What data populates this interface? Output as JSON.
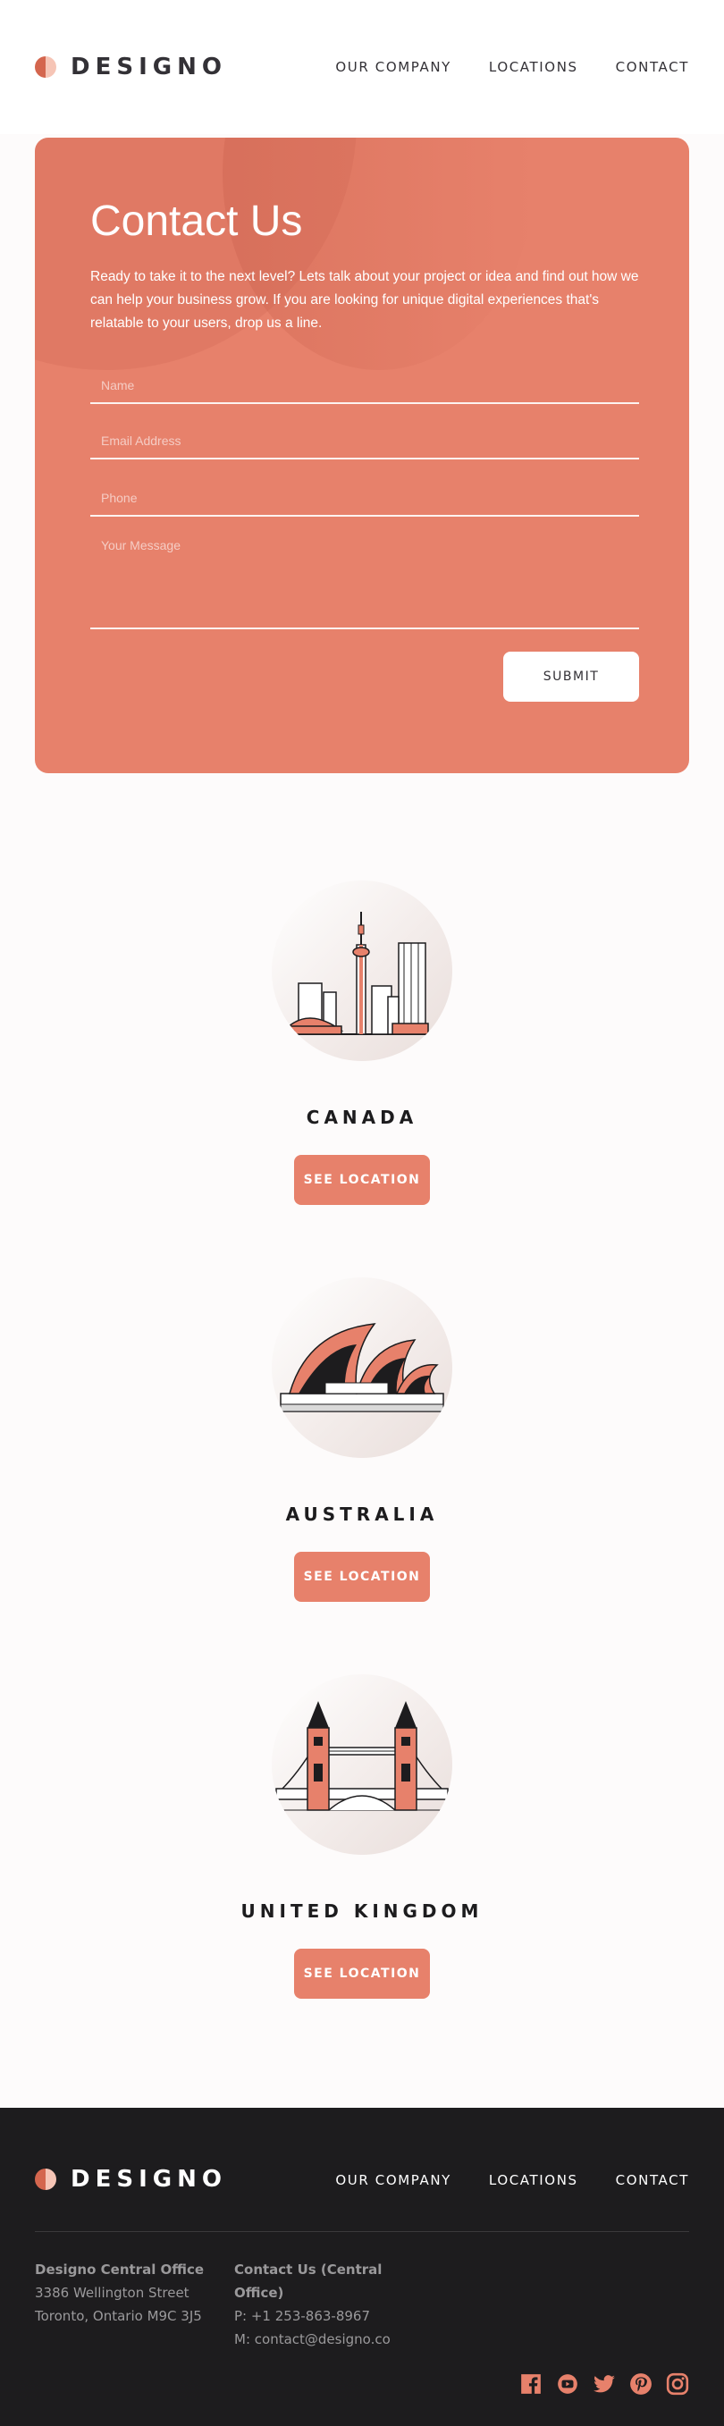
{
  "brand": {
    "name": "DESIGNO",
    "accent": "#e7816b",
    "dark": "#1d1c1e"
  },
  "nav": [
    {
      "label": "OUR COMPANY"
    },
    {
      "label": "LOCATIONS"
    },
    {
      "label": "CONTACT"
    }
  ],
  "contact": {
    "title": "Contact Us",
    "text": "Ready to take it to the next level? Lets talk about your project or idea and find out how we can help your business grow. If you are looking for unique digital experiences that's relatable to your users, drop us a line.",
    "fields": {
      "name": {
        "placeholder": "Name",
        "value": ""
      },
      "email": {
        "placeholder": "Email Address",
        "value": ""
      },
      "phone": {
        "placeholder": "Phone",
        "value": ""
      },
      "message": {
        "placeholder": "Your Message",
        "value": ""
      }
    },
    "submit_label": "SUBMIT"
  },
  "locations": [
    {
      "name": "CANADA",
      "button": "SEE LOCATION",
      "icon": "toronto-skyline-icon"
    },
    {
      "name": "AUSTRALIA",
      "button": "SEE LOCATION",
      "icon": "sydney-opera-house-icon"
    },
    {
      "name": "UNITED KINGDOM",
      "button": "SEE LOCATION",
      "icon": "tower-bridge-icon"
    }
  ],
  "footer": {
    "office1": {
      "heading": "Designo Central Office",
      "line1": "3386 Wellington Street",
      "line2": "Toronto, Ontario M9C 3J5"
    },
    "office2": {
      "heading": "Contact Us (Central Office)",
      "phone": "P: +1 253-863-8967",
      "email": "M: contact@designo.co"
    },
    "socials": [
      "facebook-icon",
      "youtube-icon",
      "twitter-icon",
      "pinterest-icon",
      "instagram-icon"
    ]
  }
}
